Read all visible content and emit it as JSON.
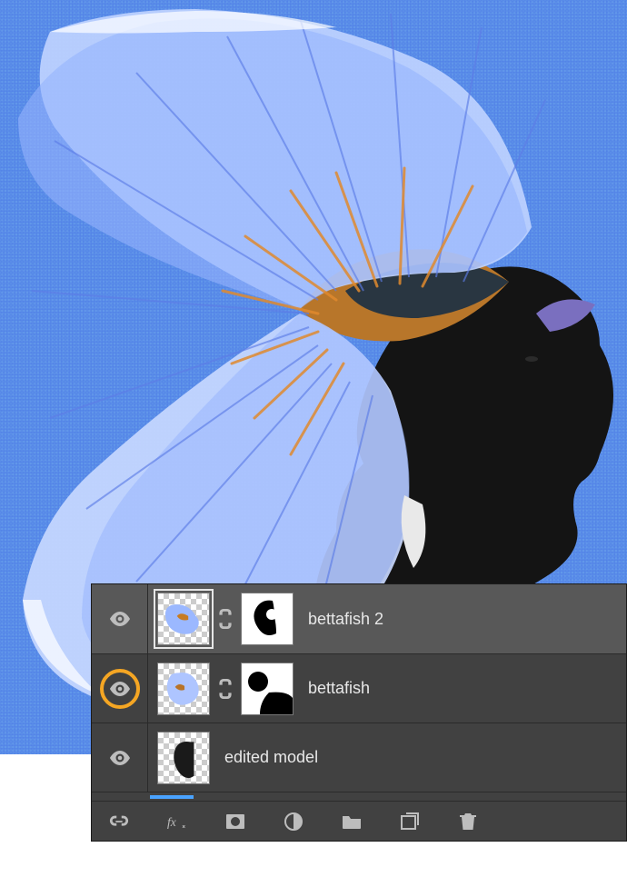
{
  "layers": [
    {
      "name": "bettafish 2",
      "visible": true,
      "hasMask": true,
      "selected": true
    },
    {
      "name": "bettafish",
      "visible": true,
      "hasMask": true,
      "highlighted": true
    },
    {
      "name": "edited model",
      "visible": true,
      "hasMask": false
    }
  ],
  "footer": {
    "icons": [
      "link-icon",
      "fx-icon",
      "mask-icon",
      "adjustment-icon",
      "group-icon",
      "new-layer-icon",
      "trash-icon"
    ]
  },
  "colors": {
    "panel": "#414141",
    "highlight": "#f5a623",
    "accent": "#4aa3ff"
  }
}
